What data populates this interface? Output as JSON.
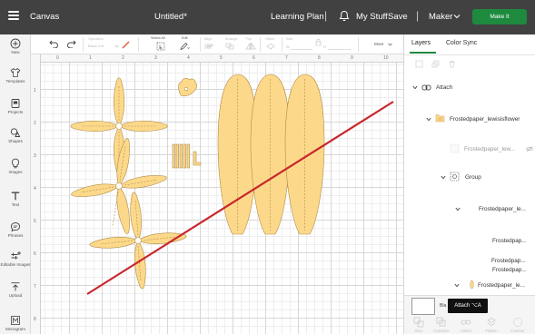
{
  "app": {
    "name": "Canvas",
    "doc_title": "Untitled*",
    "learning_plan": "Learning Plan",
    "my_stuff": "My Stuff",
    "save": "Save",
    "machine": "Maker",
    "make_it": "Make It"
  },
  "nav": [
    {
      "label": "New",
      "icon": "plus-circle-icon"
    },
    {
      "label": "Templates",
      "icon": "shirt-icon"
    },
    {
      "label": "Projects",
      "icon": "projects-icon"
    },
    {
      "label": "Shapes",
      "icon": "shapes-icon"
    },
    {
      "label": "Images",
      "icon": "lightbulb-icon"
    },
    {
      "label": "Text",
      "icon": "text-icon"
    },
    {
      "label": "Phrases",
      "icon": "speech-bubble-icon"
    },
    {
      "label": "Editable Images",
      "icon": "editable-images-icon"
    },
    {
      "label": "Upload",
      "icon": "upload-icon"
    },
    {
      "label": "Monogram",
      "icon": "monogram-icon"
    }
  ],
  "toolbar": {
    "operation_label": "Operation",
    "operation_value": "Basic Cut",
    "select_all": "Select All",
    "edit": "Edit",
    "align": "Align",
    "arrange": "Arrange",
    "flip": "Flip",
    "offset": "Offset",
    "size": "Size",
    "w_label": "W",
    "h_label": "H",
    "more": "More"
  },
  "rulers": {
    "top": [
      "0",
      "1",
      "2",
      "3",
      "4",
      "5",
      "6",
      "7",
      "8",
      "9",
      "10"
    ],
    "left": [
      "1",
      "2",
      "3",
      "4",
      "5",
      "6",
      "7",
      "8"
    ]
  },
  "panel": {
    "tabs": [
      "Layers",
      "Color Sync"
    ],
    "layers": [
      {
        "label": "Attach",
        "icon": "attach-icon",
        "indent": 0
      },
      {
        "label": "Frostedpaper_lewisisflower",
        "icon": "folder-icon",
        "indent": 1
      },
      {
        "label": "Frostedpaper_lew...",
        "icon": "blank-thumb-icon",
        "indent": 2,
        "muted": true
      },
      {
        "label": "Group",
        "icon": "group-icon",
        "indent": 2
      },
      {
        "label": "Frostedpaper_le...",
        "icon": "none",
        "indent": 3
      },
      {
        "label": "Frostedpap...",
        "icon": "none",
        "indent": 4
      },
      {
        "label": "Frostedpap...",
        "icon": "none",
        "indent": 4
      },
      {
        "label": "Frostedpap...",
        "icon": "none",
        "indent": 4
      },
      {
        "label": "Frostedpaper_le...",
        "icon": "folder-icon",
        "indent": 3
      }
    ],
    "blank_label": "Bla",
    "tooltip": "Attach ⌥A",
    "bottom_tools": [
      "Slice",
      "Combine",
      "Attach",
      "Flatten",
      "Contour"
    ]
  },
  "colors": {
    "topbar": "#414141",
    "accent": "#1e8a3e",
    "shape_fill": "#fcd98a",
    "line": "#c8282e"
  }
}
